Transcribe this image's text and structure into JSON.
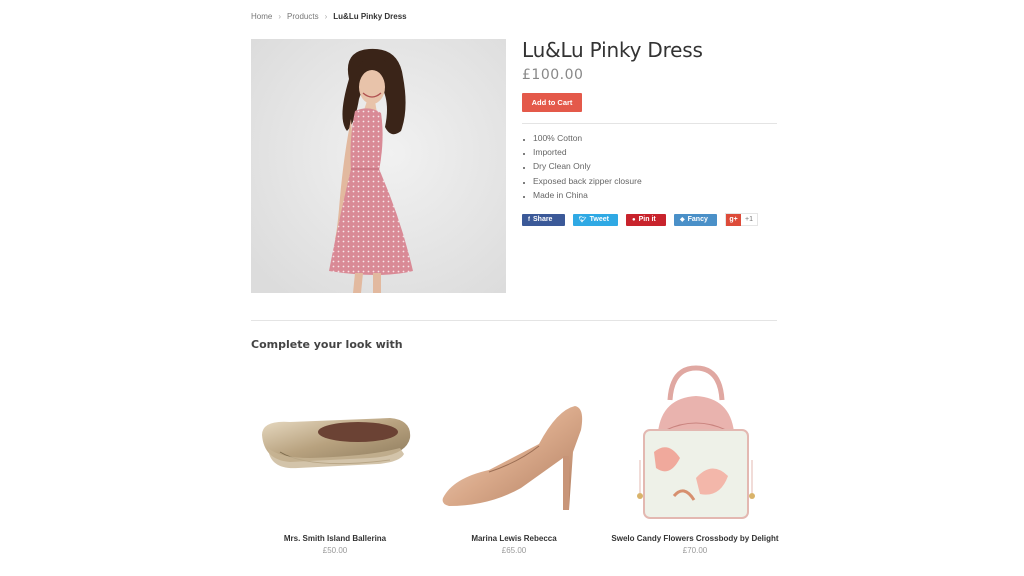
{
  "breadcrumb": {
    "home": "Home",
    "products": "Products",
    "current": "Lu&Lu Pinky Dress",
    "separator": "›"
  },
  "product": {
    "title": "Lu&Lu Pinky Dress",
    "price": "£100.00",
    "add_to_cart": "Add to Cart",
    "features": [
      "100% Cotton",
      "Imported",
      "Dry Clean Only",
      "Exposed back zipper closure",
      "Made in China"
    ],
    "image_icon": "dress-photo"
  },
  "share": {
    "facebook": "Share",
    "twitter": "Tweet",
    "pinterest": "Pin it",
    "fancy": "Fancy",
    "google_plus": "g+",
    "google_count": "+1"
  },
  "related": {
    "title": "Complete your look with",
    "items": [
      {
        "name": "Mrs. Smith Island Ballerina",
        "price": "£50.00",
        "icon": "ballet-flats-photo"
      },
      {
        "name": "Marina Lewis Rebecca",
        "price": "£65.00",
        "icon": "pump-heel-photo"
      },
      {
        "name": "Swelo Candy Flowers Crossbody by Delight",
        "price": "£70.00",
        "icon": "handbag-photo"
      }
    ]
  },
  "colors": {
    "accent": "#e4594a",
    "facebook": "#3b5998",
    "twitter": "#2fa9e4",
    "pinterest": "#c8232c",
    "fancy": "#4a90c8",
    "google": "#dd4b39"
  }
}
